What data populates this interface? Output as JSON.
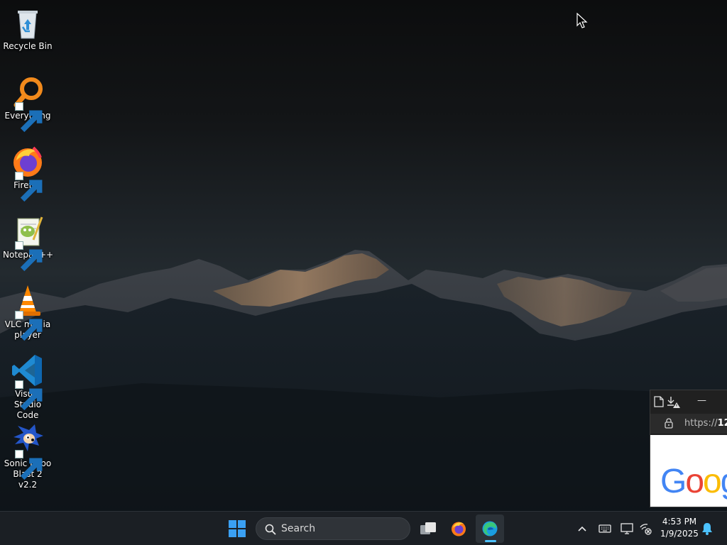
{
  "desktop": {
    "icons": [
      {
        "label": "Recycle Bin",
        "icon": "recycle-bin-icon"
      },
      {
        "label": "Everything",
        "icon": "everything-search-icon"
      },
      {
        "label": "Firefox",
        "icon": "firefox-icon"
      },
      {
        "label": "Notepad++",
        "icon": "notepad-plus-plus-icon"
      },
      {
        "label": "VLC media player",
        "icon": "vlc-cone-icon"
      },
      {
        "label": "Visual Studio Code",
        "icon": "vscode-icon"
      },
      {
        "label": "Sonic Robo Blast 2 v2.2",
        "icon": "sonic-icon"
      }
    ]
  },
  "browser_window": {
    "url_prefix": "https://",
    "url_host_visible": "12",
    "minimize_symbol": "—",
    "logo_text": "Goog"
  },
  "taskbar": {
    "search_label": "Search",
    "pinned": [
      {
        "name": "start-button",
        "icon": "windows-logo-icon"
      },
      {
        "name": "task-view",
        "icon": "task-view-icon"
      },
      {
        "name": "firefox",
        "icon": "firefox-icon"
      },
      {
        "name": "edge",
        "icon": "edge-icon",
        "active": true
      }
    ],
    "tray": {
      "time": "4:53 PM",
      "date": "1/9/2025"
    }
  },
  "colors": {
    "taskbar_bg": "#1b1f24",
    "accent": "#4cc2ff",
    "windows_blue": "#3aa0f3"
  }
}
